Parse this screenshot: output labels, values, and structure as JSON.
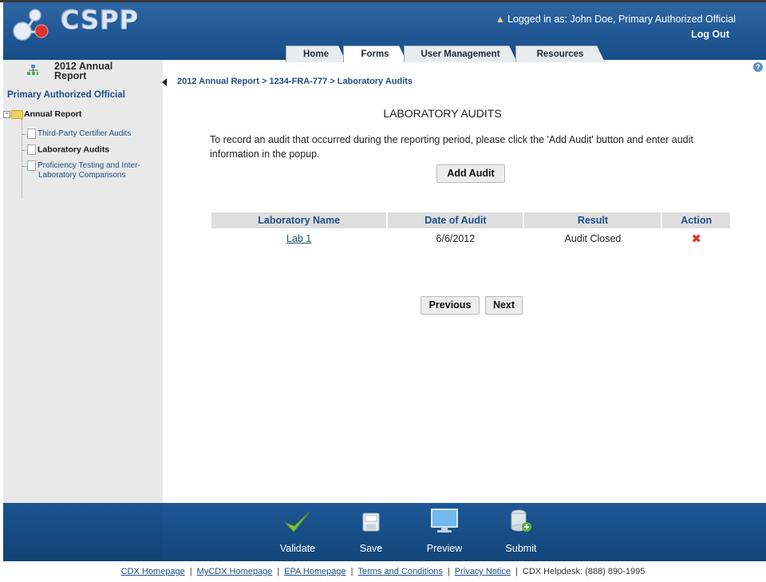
{
  "header": {
    "logo_text": "CSPP",
    "logged_in_text": "Logged in as: John Doe, Primary Authorized Official",
    "logout_label": "Log Out",
    "tabs": [
      {
        "label": "Home"
      },
      {
        "label": "Forms",
        "active": true
      },
      {
        "label": "User Management"
      },
      {
        "label": "Resources"
      }
    ]
  },
  "sidebar": {
    "title": "2012 Annual Report",
    "role": "Primary Authorized Official",
    "tree": {
      "root": "Annual Report",
      "items": [
        {
          "label": "Third-Party Certifier Audits",
          "current": false
        },
        {
          "label": "Laboratory Audits",
          "current": true
        },
        {
          "label": "Proficiency Testing and Inter-",
          "label2": "Laboratory Comparisons",
          "current": false
        }
      ]
    }
  },
  "main": {
    "breadcrumb": "2012 Annual Report > 1234-FRA-777 > Laboratory Audits",
    "title": "LABORATORY AUDITS",
    "instructions": "To record an audit that occurred during the reporting period, please click the 'Add Audit' button and enter audit information in the popup.",
    "add_button": "Add Audit",
    "table": {
      "columns": [
        "Laboratory Name",
        "Date of Audit",
        "Result",
        "Action"
      ],
      "rows": [
        {
          "lab": "Lab 1",
          "date": "6/6/2012",
          "result": "Audit Closed",
          "action_icon": "delete-icon"
        }
      ]
    },
    "previous_button": "Previous",
    "next_button": "Next"
  },
  "toolbar": {
    "validate": "Validate",
    "save": "Save",
    "preview": "Preview",
    "submit": "Submit"
  },
  "footer": {
    "links": [
      "CDX Homepage",
      "MyCDX Homepage",
      "EPA Homepage",
      "Terms and Conditions",
      "Privacy Notice"
    ],
    "helpdesk": "CDX Helpdesk: (888) 890-1995"
  },
  "colors": {
    "header_blue": "#1f5794",
    "link_blue": "#1e4e86",
    "delete_red": "#d9382c",
    "validate_green": "#7cc436"
  }
}
